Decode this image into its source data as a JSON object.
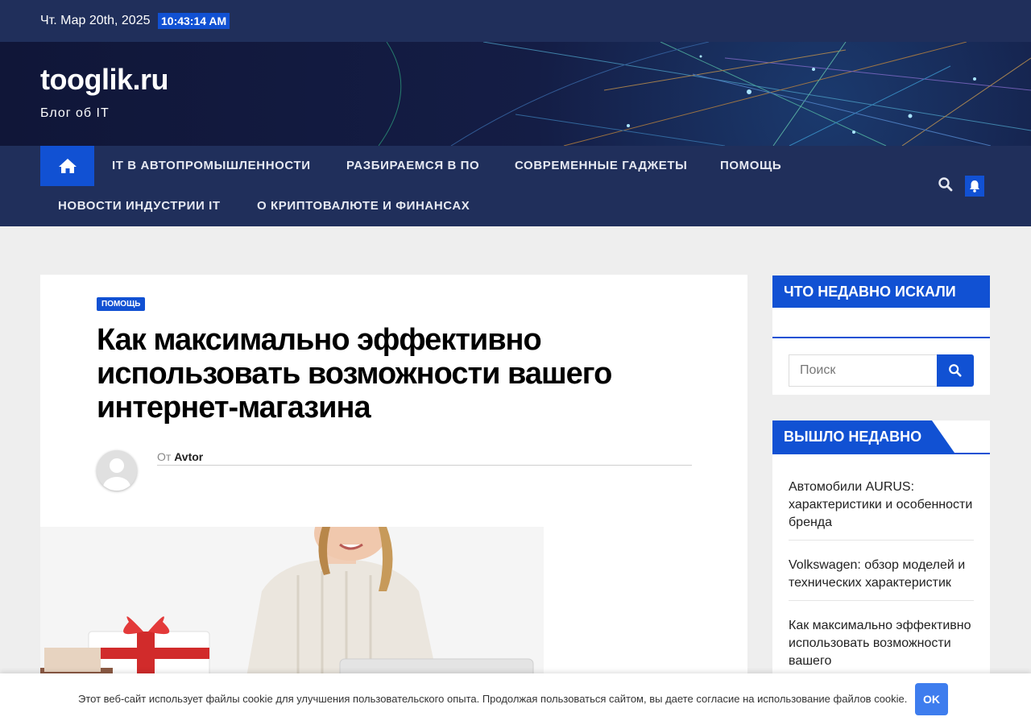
{
  "topbar": {
    "date": "Чт. Мар 20th, 2025",
    "time": "10:43:14 AM"
  },
  "header": {
    "site_title": "tooglik.ru",
    "tagline": "Блог об IT"
  },
  "nav": {
    "items": [
      "IT В АВТОПРОМЫШЛЕННОСТИ",
      "РАЗБИРАЕМСЯ В ПО",
      "СОВРЕМЕННЫЕ ГАДЖЕТЫ",
      "ПОМОЩЬ",
      "НОВОСТИ ИНДУСТРИИ IT",
      "О КРИПТОВАЛЮТЕ И ФИНАНСАХ"
    ],
    "icons": {
      "home": "home-icon",
      "search": "search-icon",
      "notifications": "bell-icon"
    }
  },
  "article": {
    "category": "ПОМОЩЬ",
    "title": "Как максимально эффективно использовать возможности вашего интернет-магазина",
    "byline_prefix": "От",
    "author": "Avtor"
  },
  "sidebar": {
    "search_title": "ЧТО НЕДАВНО ИСКАЛИ",
    "search_placeholder": "Поиск",
    "recent_title": "ВЫШЛО НЕДАВНО",
    "recent_posts": [
      "Автомобили AURUS: характеристики и особенности бренда",
      "Volkswagen: обзор моделей и технических характеристик",
      "Как максимально эффективно использовать возможности вашего"
    ]
  },
  "cookie": {
    "message": "Этот веб-сайт использует файлы cookie для улучшения пользовательского опыта. Продолжая пользоваться сайтом, вы даете согласие на использование файлов cookie.",
    "ok_label": "OK"
  },
  "colors": {
    "navy": "#202f5b",
    "accent": "#1151d3",
    "page_bg": "#eeeeee",
    "ok_button": "#3e7dee"
  }
}
